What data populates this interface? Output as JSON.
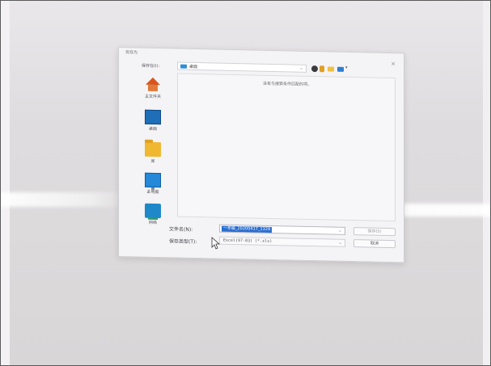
{
  "dialog": {
    "title": "另存为",
    "close_glyph": "×",
    "save_in_label": "保存在(I):",
    "location": "桌面",
    "empty_message": "没有与搜索条件匹配的项。",
    "places": [
      {
        "label": "主文件夹",
        "icon": "home-icon"
      },
      {
        "label": "桌面",
        "icon": "desktop-icon"
      },
      {
        "label": "库",
        "icon": "library-icon"
      },
      {
        "label": "此电脑",
        "icon": "computer-icon"
      },
      {
        "label": "网络",
        "icon": "network-icon"
      }
    ],
    "filename_label": "文件名(N):",
    "filename_value": "一年级_20200417_1328",
    "filetype_label": "保存类型(T):",
    "filetype_value": "Excel(97-03) (*.xls)",
    "save_button": "保存(S)",
    "cancel_button": "取消"
  },
  "toolbar": {
    "icons": [
      "back-icon",
      "up-folder-icon",
      "new-folder-icon",
      "view-menu-icon"
    ],
    "view_chevron": "▾"
  }
}
